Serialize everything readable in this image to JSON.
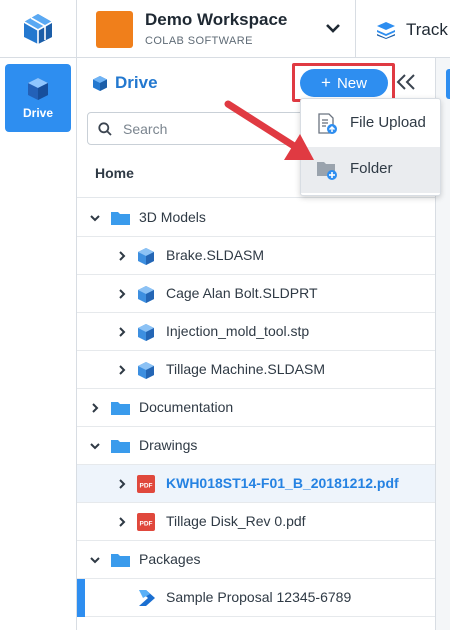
{
  "workspace": {
    "name": "Demo Workspace",
    "company": "COLAB SOFTWARE",
    "accent": "#f07f1b"
  },
  "top_nav": {
    "track_label": "Track"
  },
  "left_nav": {
    "drive_label": "Drive"
  },
  "drive": {
    "title": "Drive",
    "search_placeholder": "Search",
    "home_label": "Home",
    "new_button_label": "New",
    "new_menu": [
      {
        "label": "File Upload",
        "icon": "file-upload-icon"
      },
      {
        "label": "Folder",
        "icon": "new-folder-icon"
      }
    ],
    "tree": [
      {
        "label": "3D Models",
        "type": "folder",
        "expanded": true
      },
      {
        "label": "Brake.SLDASM",
        "type": "cad"
      },
      {
        "label": "Cage Alan Bolt.SLDPRT",
        "type": "cad"
      },
      {
        "label": "Injection_mold_tool.stp",
        "type": "cad"
      },
      {
        "label": "Tillage Machine.SLDASM",
        "type": "cad"
      },
      {
        "label": "Documentation",
        "type": "folder",
        "expanded": false
      },
      {
        "label": "Drawings",
        "type": "folder",
        "expanded": true
      },
      {
        "label": "KWH018ST14-F01_B_20181212.pdf",
        "type": "pdf",
        "active": true
      },
      {
        "label": "Tillage Disk_Rev 0.pdf",
        "type": "pdf"
      },
      {
        "label": "Packages",
        "type": "folder",
        "expanded": true
      },
      {
        "label": "Sample Proposal 12345-6789",
        "type": "package",
        "selected": true
      }
    ]
  },
  "colors": {
    "primary": "#2e8ef0",
    "highlight": "#e03a42",
    "pdf": "#e0483c"
  }
}
